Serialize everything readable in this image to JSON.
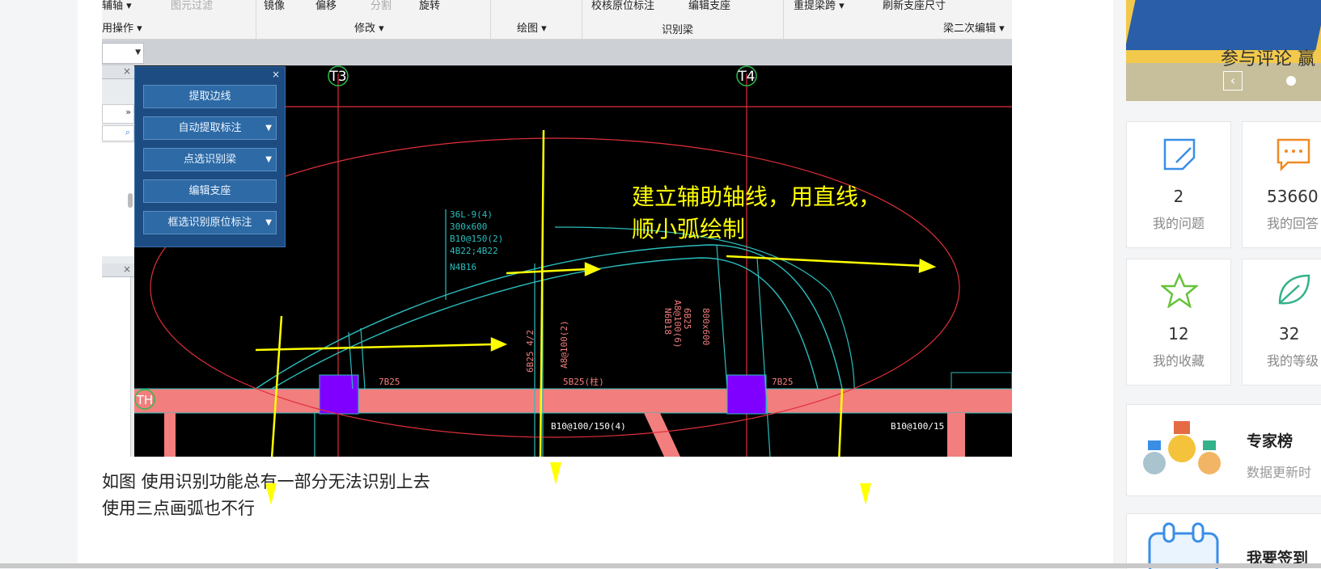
{
  "ribbon": {
    "row1": [
      "辅轴 ▾",
      "图元过滤",
      "镜像",
      "偏移",
      "分割",
      "旋转",
      "校核原位标注",
      "编辑支座",
      "重提梁跨 ▾",
      "刷新支座尺寸"
    ],
    "groups": [
      "用操作 ▾",
      "修改 ▾",
      "绘图 ▾",
      "识别梁",
      "梁二次编辑 ▾"
    ]
  },
  "toolpanel": {
    "close": "×",
    "buttons": [
      {
        "label": "提取边线",
        "dropdown": false
      },
      {
        "label": "自动提取标注",
        "dropdown": true
      },
      {
        "label": "点选识别梁",
        "dropdown": true
      },
      {
        "label": "编辑支座",
        "dropdown": false
      },
      {
        "label": "框选识别原位标注",
        "dropdown": true
      }
    ]
  },
  "cad": {
    "axis_labels": [
      "T3",
      "T4",
      "TH"
    ],
    "annotation_line1": "建立辅助轴线，用直线，",
    "annotation_line2": "顺小弧绘制",
    "beam_labels": [
      "36L-9(4)",
      "300x600",
      "B10@150(2)",
      "4B22;4B22",
      "N4B16",
      "7B25",
      "5B25(柱)",
      "6B25 4/2",
      "A8@100(2)",
      "800x600",
      "A8@100(6)",
      "6B25",
      "N6B18",
      "7B25",
      "B10@100/150(4)",
      "B10@100/15"
    ],
    "colors": {
      "axis": "#e0303a",
      "beam": "#2bbdbd",
      "highlight": "#ff6b6b",
      "column": "#8000ff",
      "arrow": "#ffff00",
      "ellipse": "#e0303a"
    }
  },
  "caption": {
    "line1": "如图 使用识别功能总有一部分无法识别上去",
    "line2": "使用三点画弧也不行"
  },
  "sidebar": {
    "banner_text": "参与评论 赢",
    "stats": [
      {
        "value": "2",
        "label": "我的问题",
        "icon": "question-edit-icon",
        "color": "#3a8ee6"
      },
      {
        "value": "53660",
        "label": "我的回答",
        "icon": "chat-bubble-icon",
        "color": "#f08a24"
      },
      {
        "value": "12",
        "label": "我的收藏",
        "icon": "star-icon",
        "color": "#67c23a"
      },
      {
        "value": "32",
        "label": "我的等级",
        "icon": "leaf-icon",
        "color": "#34b28a"
      }
    ],
    "expert": {
      "title": "专家榜",
      "subtitle": "数据更新时"
    },
    "checkin": {
      "title": "我要签到"
    }
  }
}
